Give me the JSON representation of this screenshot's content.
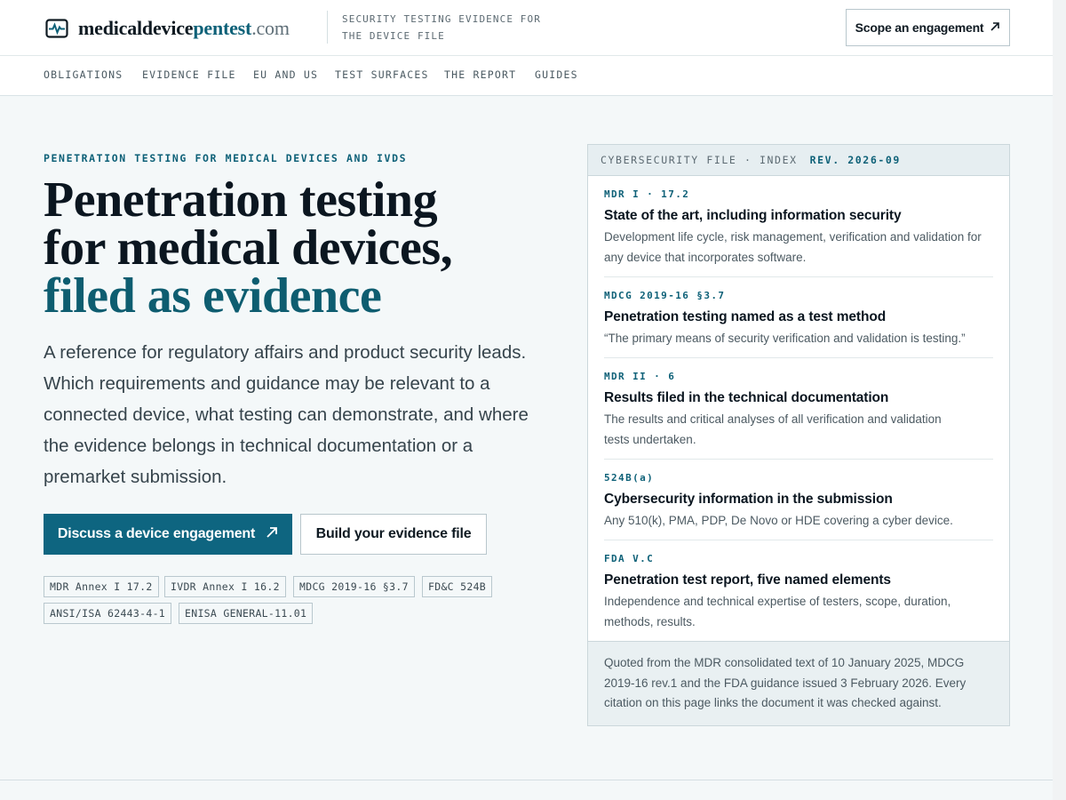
{
  "header": {
    "logo": {
      "part1": "medicaldevice",
      "part2": "pentest",
      "part3": ".com"
    },
    "tagline": "SECURITY TESTING EVIDENCE FOR THE DEVICE FILE",
    "cta": {
      "label": "Scope an engagement",
      "icon": "arrow-up-right-icon"
    }
  },
  "nav": {
    "items": [
      "OBLIGATIONS",
      "EVIDENCE FILE",
      "EU AND US",
      "TEST SURFACES",
      "THE REPORT",
      "GUIDES"
    ]
  },
  "hero": {
    "eyebrow": "PENETRATION TESTING FOR MEDICAL DEVICES AND IVDS",
    "headline": {
      "line1": "Penetration testing",
      "line2": "for medical devices,",
      "line3": "filed as evidence"
    },
    "lede": "A reference for regulatory affairs and product security leads. Which requirements and guidance may be relevant to a connected device, what testing can demonstrate, and where the evidence belongs in technical documentation or a premarket submission.",
    "primary_button": "Discuss a device engagement",
    "secondary_button": "Build your evidence file",
    "chips": [
      "MDR Annex I 17.2",
      "IVDR Annex I 16.2",
      "MDCG 2019-16 §3.7",
      "FD&C 524B",
      "ANSI/ISA 62443-4-1",
      "ENISA GENERAL-11.01"
    ]
  },
  "card": {
    "label": "CYBERSECURITY FILE · INDEX",
    "revision": "REV. 2026-09",
    "entries": [
      {
        "ref": "MDR I · 17.2",
        "title": "State of the art, including information security",
        "desc": "Development life cycle, risk management, verification and validation for any device that incorporates software."
      },
      {
        "ref": "MDCG 2019-16 §3.7",
        "title": "Penetration testing named as a test method",
        "desc": "“The primary means of security verification and validation is testing.”"
      },
      {
        "ref": "MDR II · 6",
        "title": "Results filed in the technical documentation",
        "desc": "The results and critical analyses of all verification and validation tests undertaken."
      },
      {
        "ref": "524B(a)",
        "title": "Cybersecurity information in the submission",
        "desc": "Any 510(k), PMA, PDP, De Novo or HDE covering a cyber device."
      },
      {
        "ref": "FDA V.C",
        "title": "Penetration test report, five named elements",
        "desc": "Independence and technical expertise of testers, scope, duration, methods, results."
      }
    ],
    "footnote": "Quoted from the MDR consolidated text of 10 January 2025, MDCG 2019-16 rev.1 and the FDA guidance issued 3 February 2026. Every citation on this page links the document it was checked against."
  },
  "colors": {
    "accent": "#0e6178",
    "primary_button": "#0e6580",
    "page_background": "#f4f8f9"
  }
}
